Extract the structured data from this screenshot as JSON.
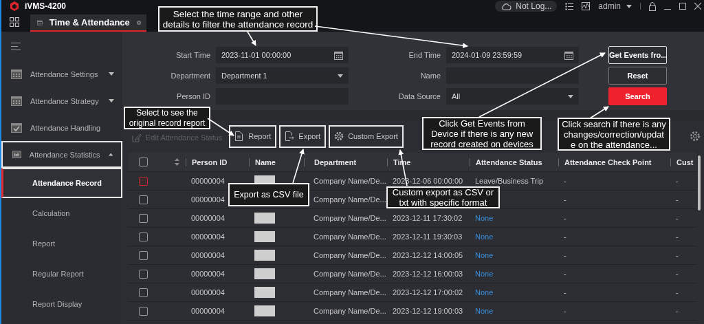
{
  "app": {
    "name": "iVMS-4200"
  },
  "top_bar": {
    "cloud_status": "Not Log...",
    "user": "admin"
  },
  "tabs": [
    {
      "label": "Time & Attendance",
      "selected": true
    }
  ],
  "sidebar": {
    "items": [
      {
        "label": "Attendance Settings",
        "expanded": false,
        "selected": false,
        "outlined": false
      },
      {
        "label": "Attendance Strategy",
        "expanded": false,
        "selected": false,
        "outlined": false
      },
      {
        "label": "Attendance Handling",
        "selected": false,
        "outlined": false
      },
      {
        "label": "Attendance Statistics",
        "expanded": true,
        "selected": false,
        "outlined": true,
        "children": [
          {
            "label": "Attendance Record",
            "selected": true,
            "outlined": true
          },
          {
            "label": "Calculation",
            "selected": false,
            "outlined": false
          },
          {
            "label": "Report",
            "selected": false,
            "outlined": false
          },
          {
            "label": "Regular Report",
            "selected": false,
            "outlined": false
          },
          {
            "label": "Report Display",
            "selected": false,
            "outlined": false
          }
        ]
      }
    ]
  },
  "filters": [
    {
      "label": "Start Time",
      "kind": "date",
      "value": "2023-11-01 00:00:00"
    },
    {
      "label": "End Time",
      "kind": "date",
      "value": "2024-01-09 23:59:59"
    },
    {
      "label": "Department",
      "kind": "select",
      "value": "Department 1"
    },
    {
      "label": "Name",
      "kind": "text"
    },
    {
      "label": "Person ID",
      "kind": "text"
    },
    {
      "label": "Data Source",
      "kind": "select",
      "value": "All"
    }
  ],
  "filter_buttons": [
    {
      "label": "Get Events fro...",
      "kind": "outline",
      "outlined": true
    },
    {
      "label": "Reset",
      "kind": "outline",
      "outlined": false
    },
    {
      "label": "Search",
      "kind": "primary",
      "outlined": false
    }
  ],
  "toolbar": [
    {
      "label": "Edit Attendance Status",
      "disabled": true,
      "outlined": false
    },
    {
      "label": "Report",
      "disabled": false,
      "outlined": true
    },
    {
      "label": "Export",
      "disabled": false,
      "outlined": true
    },
    {
      "label": "Custom Export",
      "disabled": false,
      "outlined": true
    }
  ],
  "table": {
    "select_all_checked": false,
    "columns": [
      "Person ID",
      "Name",
      "Department",
      "Time",
      "Attendance Status",
      "Attendance Check Point",
      "Cust"
    ],
    "rows": [
      {
        "person_id": "00000004",
        "name_redacted": true,
        "department": "Company Name/De...",
        "time": "2023-12-06 00:00:00",
        "status": "Leave/Business Trip",
        "status_link": false,
        "check_point": "-",
        "column_7": "-",
        "highlighted": true
      },
      {
        "person_id": "00000004",
        "department": "Company Name/De...",
        "check_point": "-",
        "column_7": "-",
        "highlighted": false
      },
      {
        "person_id": "00000004",
        "department": "Company Name/De...",
        "name_redacted": true,
        "time": "2023-12-11 17:30:02",
        "status": "None",
        "status_link": true,
        "check_point": "-",
        "column_7": "-",
        "highlighted": false
      },
      {
        "person_id": "00000004",
        "department": "Company Name/De...",
        "name_redacted": true,
        "time": "2023-12-11 19:30:03",
        "status": "None",
        "status_link": true,
        "check_point": "-",
        "column_7": "-",
        "highlighted": false
      },
      {
        "person_id": "00000004",
        "department": "Company Name/De...",
        "name_redacted": true,
        "time": "2023-12-12 14:00:05",
        "status": "None",
        "status_link": true,
        "check_point": "-",
        "column_7": "-",
        "highlighted": false
      },
      {
        "person_id": "00000004",
        "department": "Company Name/De...",
        "name_redacted": true,
        "time": "2023-12-12 16:00:03",
        "status": "None",
        "status_link": true,
        "check_point": "-",
        "column_7": "-",
        "highlighted": false
      },
      {
        "person_id": "00000004",
        "department": "Company Name/De...",
        "name_redacted": true,
        "time": "2023-12-12 17:00:02",
        "status": "None",
        "status_link": true,
        "check_point": "-",
        "column_7": "-",
        "highlighted": false
      },
      {
        "person_id": "00000004",
        "department": "Company Name/De...",
        "name_redacted": true,
        "time": "2023-12-12 19:00:03",
        "status": "None",
        "status_link": true,
        "check_point": "-",
        "column_7": "-",
        "highlighted": false
      }
    ]
  },
  "callouts": [
    {
      "lines": [
        "Select the time range and other",
        "details to filter the attendance record"
      ]
    },
    {
      "lines": [
        "Select to see the",
        "original record report"
      ]
    },
    {
      "lines": [
        "Export as CSV file"
      ]
    },
    {
      "lines": [
        "Custom export as CSV or",
        "txt with specific format"
      ]
    },
    {
      "lines": [
        "Click Get Events from",
        "Device if there is any new",
        "record created on devices"
      ]
    },
    {
      "lines": [
        "Click search if there is any",
        "changes/correction/updat",
        "e on the attendance..."
      ]
    }
  ]
}
